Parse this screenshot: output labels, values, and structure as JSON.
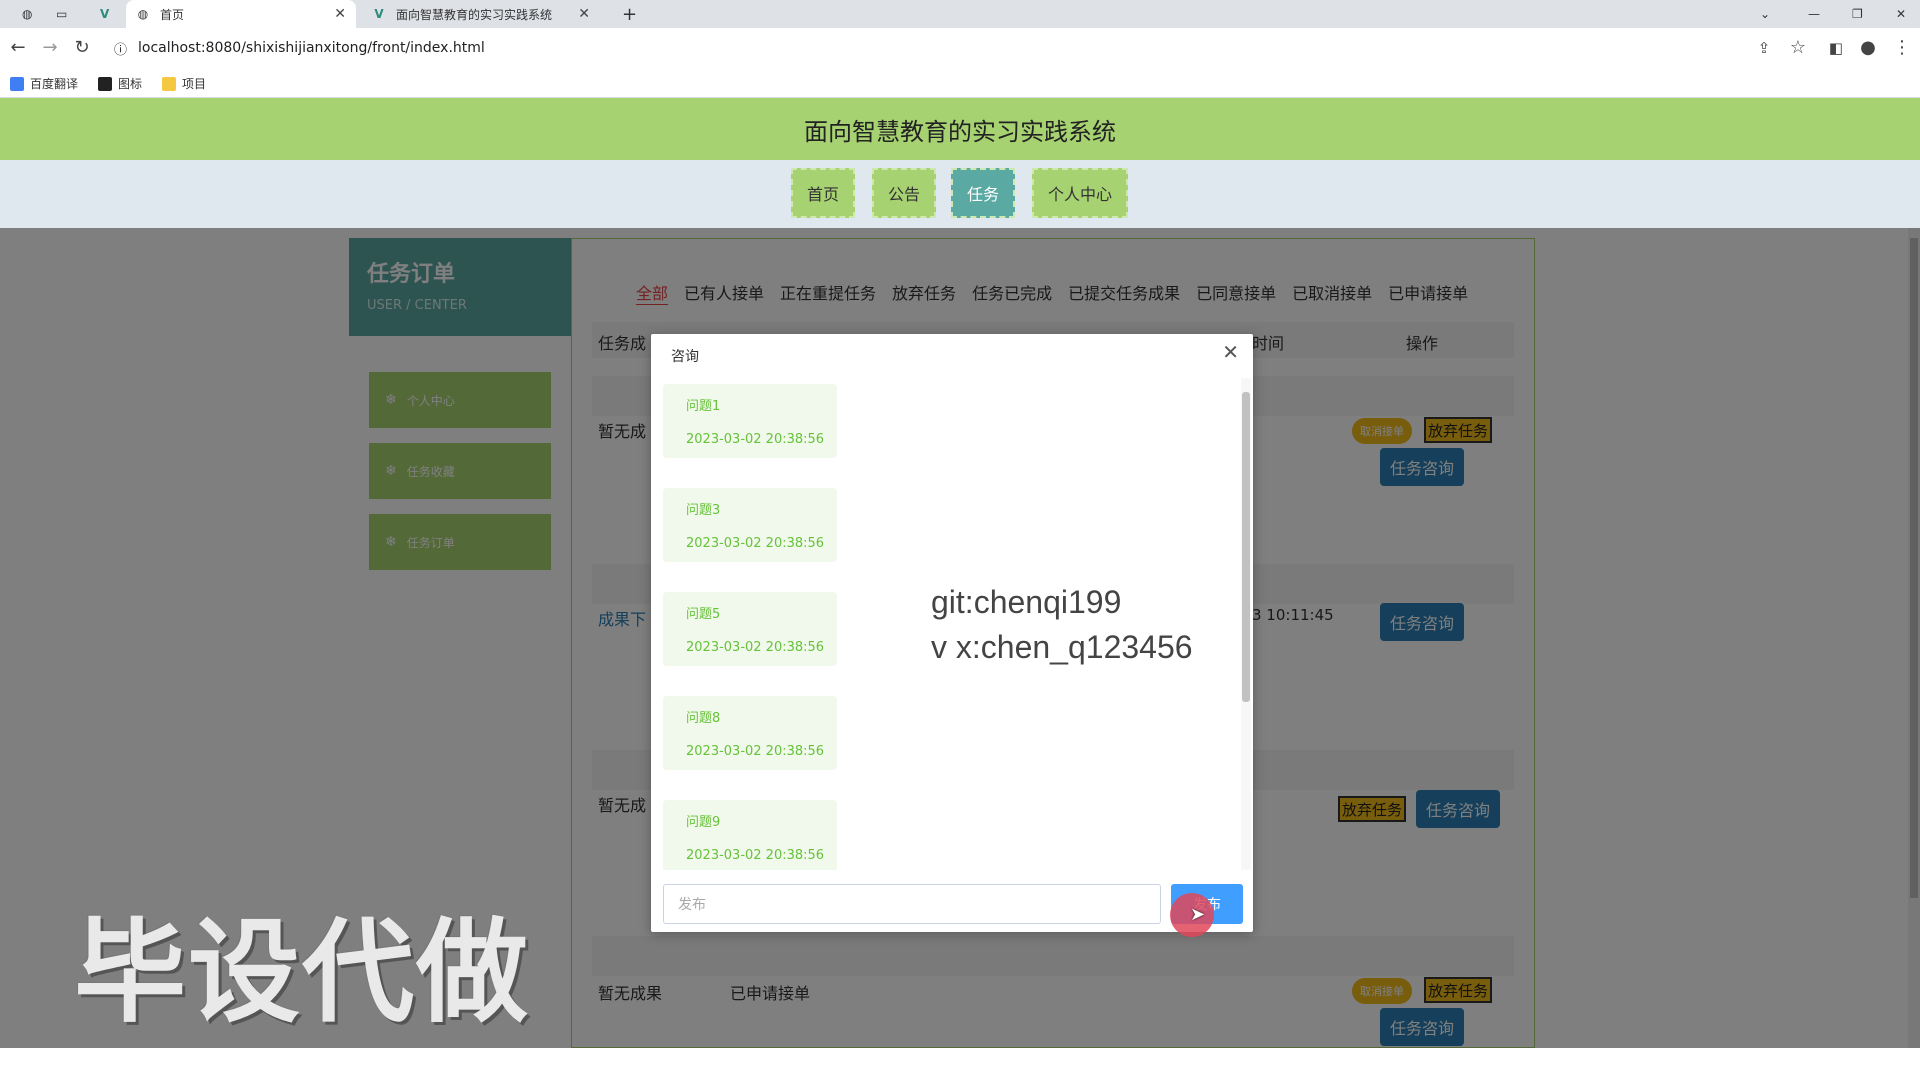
{
  "browser": {
    "tabs": [
      {
        "label": "首页",
        "active": true
      },
      {
        "label": "面向智慧教育的实习实践系统",
        "active": false
      }
    ],
    "url": "localhost:8080/shixishijianxitong/front/index.html",
    "bookmarks": [
      "百度翻译",
      "图标",
      "项目"
    ]
  },
  "site": {
    "title": "面向智慧教育的实习实践系统",
    "nav": [
      "首页",
      "公告",
      "任务",
      "个人中心"
    ]
  },
  "sidebar": {
    "title": "任务订单",
    "subtitle": "USER / CENTER",
    "items": [
      "个人中心",
      "任务收藏",
      "任务订单"
    ]
  },
  "filters": [
    "全部",
    "已有人接单",
    "正在重提任务",
    "放弃任务",
    "任务已完成",
    "已提交任务成果",
    "已同意接单",
    "已取消接单",
    "已申请接单"
  ],
  "table": {
    "col_left": "任务成",
    "col_time": "时间",
    "col_action": "操作",
    "rows": [
      {
        "result": "暂无成",
        "cancel": "取消接单",
        "abandon": "放弃任务",
        "consult": "任务咨询"
      },
      {
        "result": "成果下",
        "time": "3 10:11:45",
        "consult": "任务咨询"
      },
      {
        "result": "暂无成",
        "abandon": "放弃任务",
        "consult": "任务咨询"
      },
      {
        "result": "暂无成果",
        "status": "已申请接单",
        "cancel": "取消接单",
        "abandon": "放弃任务",
        "consult": "任务咨询"
      }
    ]
  },
  "dialog": {
    "title": "咨询",
    "messages": [
      {
        "q": "问题1",
        "date": "2023-03-02 20:38:56"
      },
      {
        "q": "问题3",
        "date": "2023-03-02 20:38:56"
      },
      {
        "q": "问题5",
        "date": "2023-03-02 20:38:56"
      },
      {
        "q": "问题8",
        "date": "2023-03-02 20:38:56"
      },
      {
        "q": "问题9",
        "date": "2023-03-02 20:38:56"
      }
    ],
    "overlay_line1": "git:chenqi199",
    "overlay_line2": "v x:chen_q123456",
    "input_placeholder": "发布",
    "post_button": "发布"
  },
  "watermark": "毕设代做",
  "colors": {
    "header": "#a7d271",
    "accent": "#5aa9a2",
    "consult": "#2b7fb4",
    "abandon": "#f1bb1b"
  }
}
